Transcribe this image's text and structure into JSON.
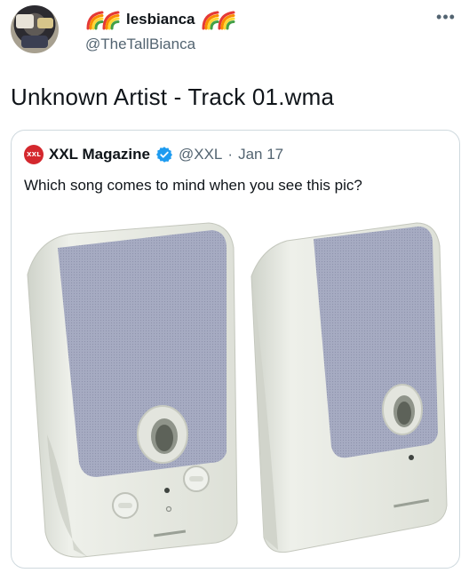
{
  "author": {
    "display_name": "lesbianca",
    "handle": "@TheTallBianca",
    "avatar_icon": "profile-photo"
  },
  "tweet": {
    "text": "Unknown Artist - Track 01.wma"
  },
  "quoted_tweet": {
    "logo_text": "XXL",
    "display_name": "XXL Magazine",
    "verified_icon": "verified-badge-icon",
    "handle": "@XXL",
    "separator": "·",
    "date": "Jan 17",
    "text": "Which song comes to mind when you see this pic?",
    "image": {
      "subject": "computer-speakers",
      "colors": {
        "body": "#e4e7df",
        "grille": "#a9aec4",
        "shadow": "#c9cdc4"
      }
    }
  },
  "colors": {
    "text": "#0f1419",
    "muted": "#536471",
    "border": "#cfd9de",
    "verified": "#1d9bf0",
    "xxl_red": "#d4282e"
  }
}
